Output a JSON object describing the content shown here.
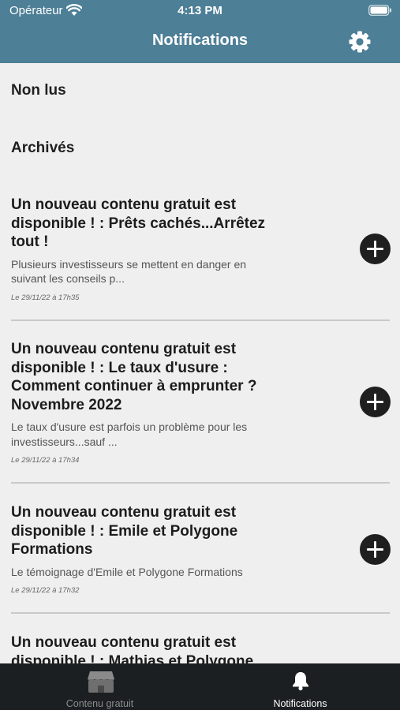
{
  "status_bar": {
    "carrier": "Opérateur",
    "time": "4:13 PM"
  },
  "header": {
    "title": "Notifications",
    "settings_icon": "gear-icon"
  },
  "sections": {
    "unread": "Non lus",
    "archived": "Archivés"
  },
  "notifications": [
    {
      "title": "Un nouveau contenu gratuit est disponible ! : Prêts cachés...Arrêtez tout !",
      "description": "Plusieurs investisseurs se mettent en danger en suivant les conseils p...",
      "date": "Le 29/11/22 à 17h35"
    },
    {
      "title": "Un nouveau contenu gratuit est disponible ! : Le taux d'usure : Comment continuer à emprunter ? Novembre 2022",
      "description": "Le taux d'usure est parfois un problème pour les investisseurs...sauf ...",
      "date": "Le 29/11/22 à 17h34"
    },
    {
      "title": "Un nouveau contenu gratuit est disponible ! : Emile et Polygone Formations",
      "description": "Le témoignage d'Emile et Polygone Formations",
      "date": "Le 29/11/22 à 17h32"
    },
    {
      "title": "Un nouveau contenu gratuit est disponible ! : Mathias et Polygone",
      "description": "",
      "date": ""
    }
  ],
  "tabbar": {
    "tabs": [
      {
        "label": "Contenu gratuit",
        "icon": "store-icon",
        "active": false
      },
      {
        "label": "Notifications",
        "icon": "bell-icon",
        "active": true
      }
    ]
  },
  "colors": {
    "header": "#4d7f97",
    "tabbar": "#1b1f21",
    "background": "#efefef"
  }
}
